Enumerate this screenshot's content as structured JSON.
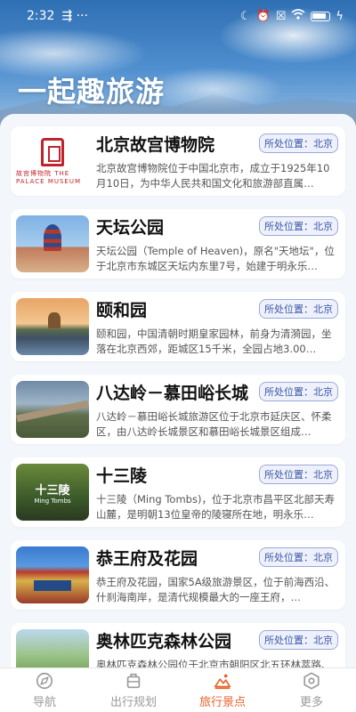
{
  "status_bar": {
    "time": "2:32",
    "left_icons": "⇶ ···",
    "right_icons": [
      "moon-icon",
      "alarm-off-icon",
      "sim-off-icon",
      "wifi-icon",
      "battery-icon"
    ]
  },
  "app_title": "一起趣旅游",
  "spots": [
    {
      "name": "北京故宫博物院",
      "location": "所处位置：北京",
      "desc": "北京故宫博物院位于中国北京市，成立于1925年10月10日，为中华人民共和国文化和旅游部直属…",
      "thumb_caption": "故宫博物院 THE PALACE MUSEUM"
    },
    {
      "name": "天坛公园",
      "location": "所处位置：北京",
      "desc": "天坛公园（Temple of Heaven)，原名\"天地坛\"，位于北京市东城区天坛内东里7号，始建于明永乐…"
    },
    {
      "name": "颐和园",
      "location": "所处位置：北京",
      "desc": "颐和园，中国清朝时期皇家园林，前身为清漪园，坐落在北京西郊，距城区15千米，全园占地3.00…"
    },
    {
      "name": "八达岭－慕田峪长城",
      "location": "所处位置：北京",
      "desc": "八达岭－慕田峪长城旅游区位于北京市延庆区、怀柔区，由八达岭长城景区和慕田峪长城景区组成…"
    },
    {
      "name": "十三陵",
      "location": "所处位置：北京",
      "desc": "十三陵（Ming Tombs)，位于北京市昌平区北部天寿山麓，是明朝13位皇帝的陵寝所在地，明永乐…",
      "thumb_title": "十三陵",
      "thumb_subtitle": "Ming Tombs"
    },
    {
      "name": "恭王府及花园",
      "location": "所处位置：北京",
      "desc": "恭王府及花园，国家5A级旅游景区，位于前海西沿、什刹海南岸，是清代规模最大的一座王府，…"
    },
    {
      "name": "奥林匹克森林公园",
      "location": "所处位置：北京",
      "desc": "奥林匹克森林公园位于北京市朝阳区北五环林萃路、东至安立路、西至林萃路、北至清河、南至…"
    }
  ],
  "bottom_nav": [
    {
      "label": "导航",
      "icon": "navigation-icon",
      "active": false
    },
    {
      "label": "出行规划",
      "icon": "luggage-icon",
      "active": false
    },
    {
      "label": "旅行景点",
      "icon": "landscape-icon",
      "active": true
    },
    {
      "label": "更多",
      "icon": "settings-hexagon-icon",
      "active": false
    }
  ],
  "colors": {
    "accent": "#e8632b",
    "badge_text": "#3a58a8",
    "badge_border": "#9aaad8"
  }
}
